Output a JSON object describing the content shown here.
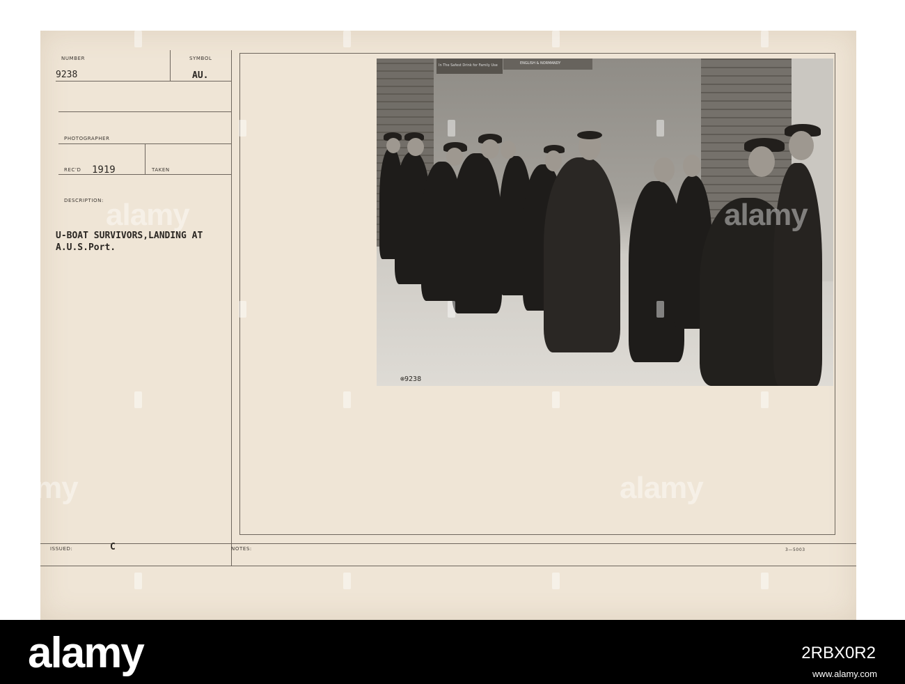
{
  "card": {
    "number_label": "NUMBER",
    "number_value": "9238",
    "symbol_label": "SYMBOL",
    "symbol_value": "AU.",
    "photographer_label": "PHOTOGRAPHER",
    "recd_label": "REC'D",
    "recd_value": "1919",
    "taken_label": "TAKEN",
    "description_label": "DESCRIPTION:",
    "description_line1": "U-BOAT SURVIVORS,LANDING AT",
    "description_line2": "A.U.S.Port.",
    "issued_label": "ISSUED:",
    "issued_value": "C",
    "notes_label": "NOTES:",
    "form_number": "3—5003"
  },
  "photo": {
    "negative_number": "⊗9238",
    "poster_text_1": "In The Safest Drink for Family Use",
    "poster_text_2": "ENGLISH & NORMANDY"
  },
  "watermark": {
    "text": "alamy"
  },
  "footer": {
    "brand": "alamy",
    "image_id": "2RBX0R2",
    "meta": "www.alamy.com"
  }
}
